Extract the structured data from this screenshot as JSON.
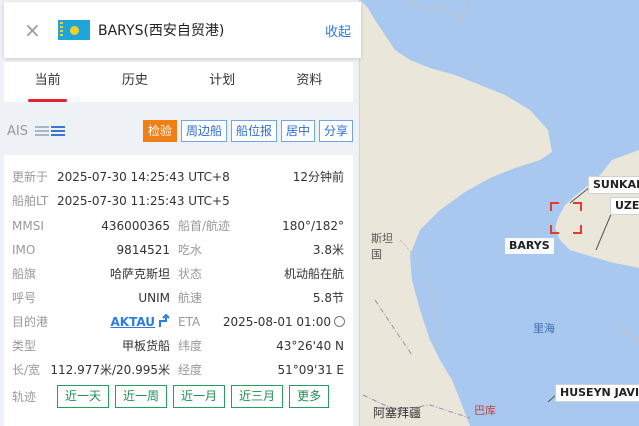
{
  "header": {
    "ship_name": "BARYS(西安自贸港)",
    "collapse_label": "收起",
    "close_symbol": "×"
  },
  "tabs": [
    {
      "label": "当前",
      "active": true
    },
    {
      "label": "历史",
      "active": false
    },
    {
      "label": "计划",
      "active": false
    },
    {
      "label": "资料",
      "active": false
    }
  ],
  "ais": {
    "label": "AIS",
    "buttons": [
      "检验",
      "周边船",
      "船位报",
      "居中",
      "分享"
    ]
  },
  "info": {
    "updated_label": "更新于",
    "updated_value": "2025-07-30 14:25:43 UTC+8",
    "updated_ago": "12分钟前",
    "lt_label": "船舶LT",
    "lt_value": "2025-07-30 11:25:43 UTC+5",
    "mmsi_label": "MMSI",
    "mmsi_value": "436000365",
    "heading_label": "船首/航迹",
    "heading_value": "180°/182°",
    "imo_label": "IMO",
    "imo_value": "9814521",
    "draft_label": "吃水",
    "draft_value": "3.8米",
    "flag_label": "船旗",
    "flag_value": "哈萨克斯坦",
    "status_label": "状态",
    "status_value": "机动船在航",
    "callsign_label": "呼号",
    "callsign_value": "UNIM",
    "speed_label": "航速",
    "speed_value": "5.8节",
    "dest_label": "目的港",
    "dest_value": "AKTAU",
    "eta_label": "ETA",
    "eta_value": "2025-08-01 01:00",
    "type_label": "类型",
    "type_value": "甲板货船",
    "lat_label": "纬度",
    "lat_value": "43°26'40 N",
    "size_label": "长/宽",
    "size_value": "112.977米/20.995米",
    "lon_label": "经度",
    "lon_value": "51°09'31 E",
    "track_label": "轨迹",
    "track_buttons": [
      "近一天",
      "近一周",
      "近一月",
      "近三月",
      "更多"
    ]
  },
  "map": {
    "labels": {
      "kz_partial": "斯坦",
      "country2_partial": "国",
      "sea": "里海",
      "bottom_left": "阿塞拜疆",
      "baku": "巴库"
    },
    "ship_tags": [
      "SUNKAR",
      "BARYS",
      "UZEY",
      "HUSEYN JAVID"
    ]
  },
  "colors": {
    "sea": "#a9c8ef",
    "land": "#ebe6da",
    "accent_red": "#e0252f",
    "primary_orange": "#f08016",
    "link_blue": "#2c7be5",
    "track_green": "#25a05a",
    "vessel_yellow": "#f4ec1c"
  }
}
